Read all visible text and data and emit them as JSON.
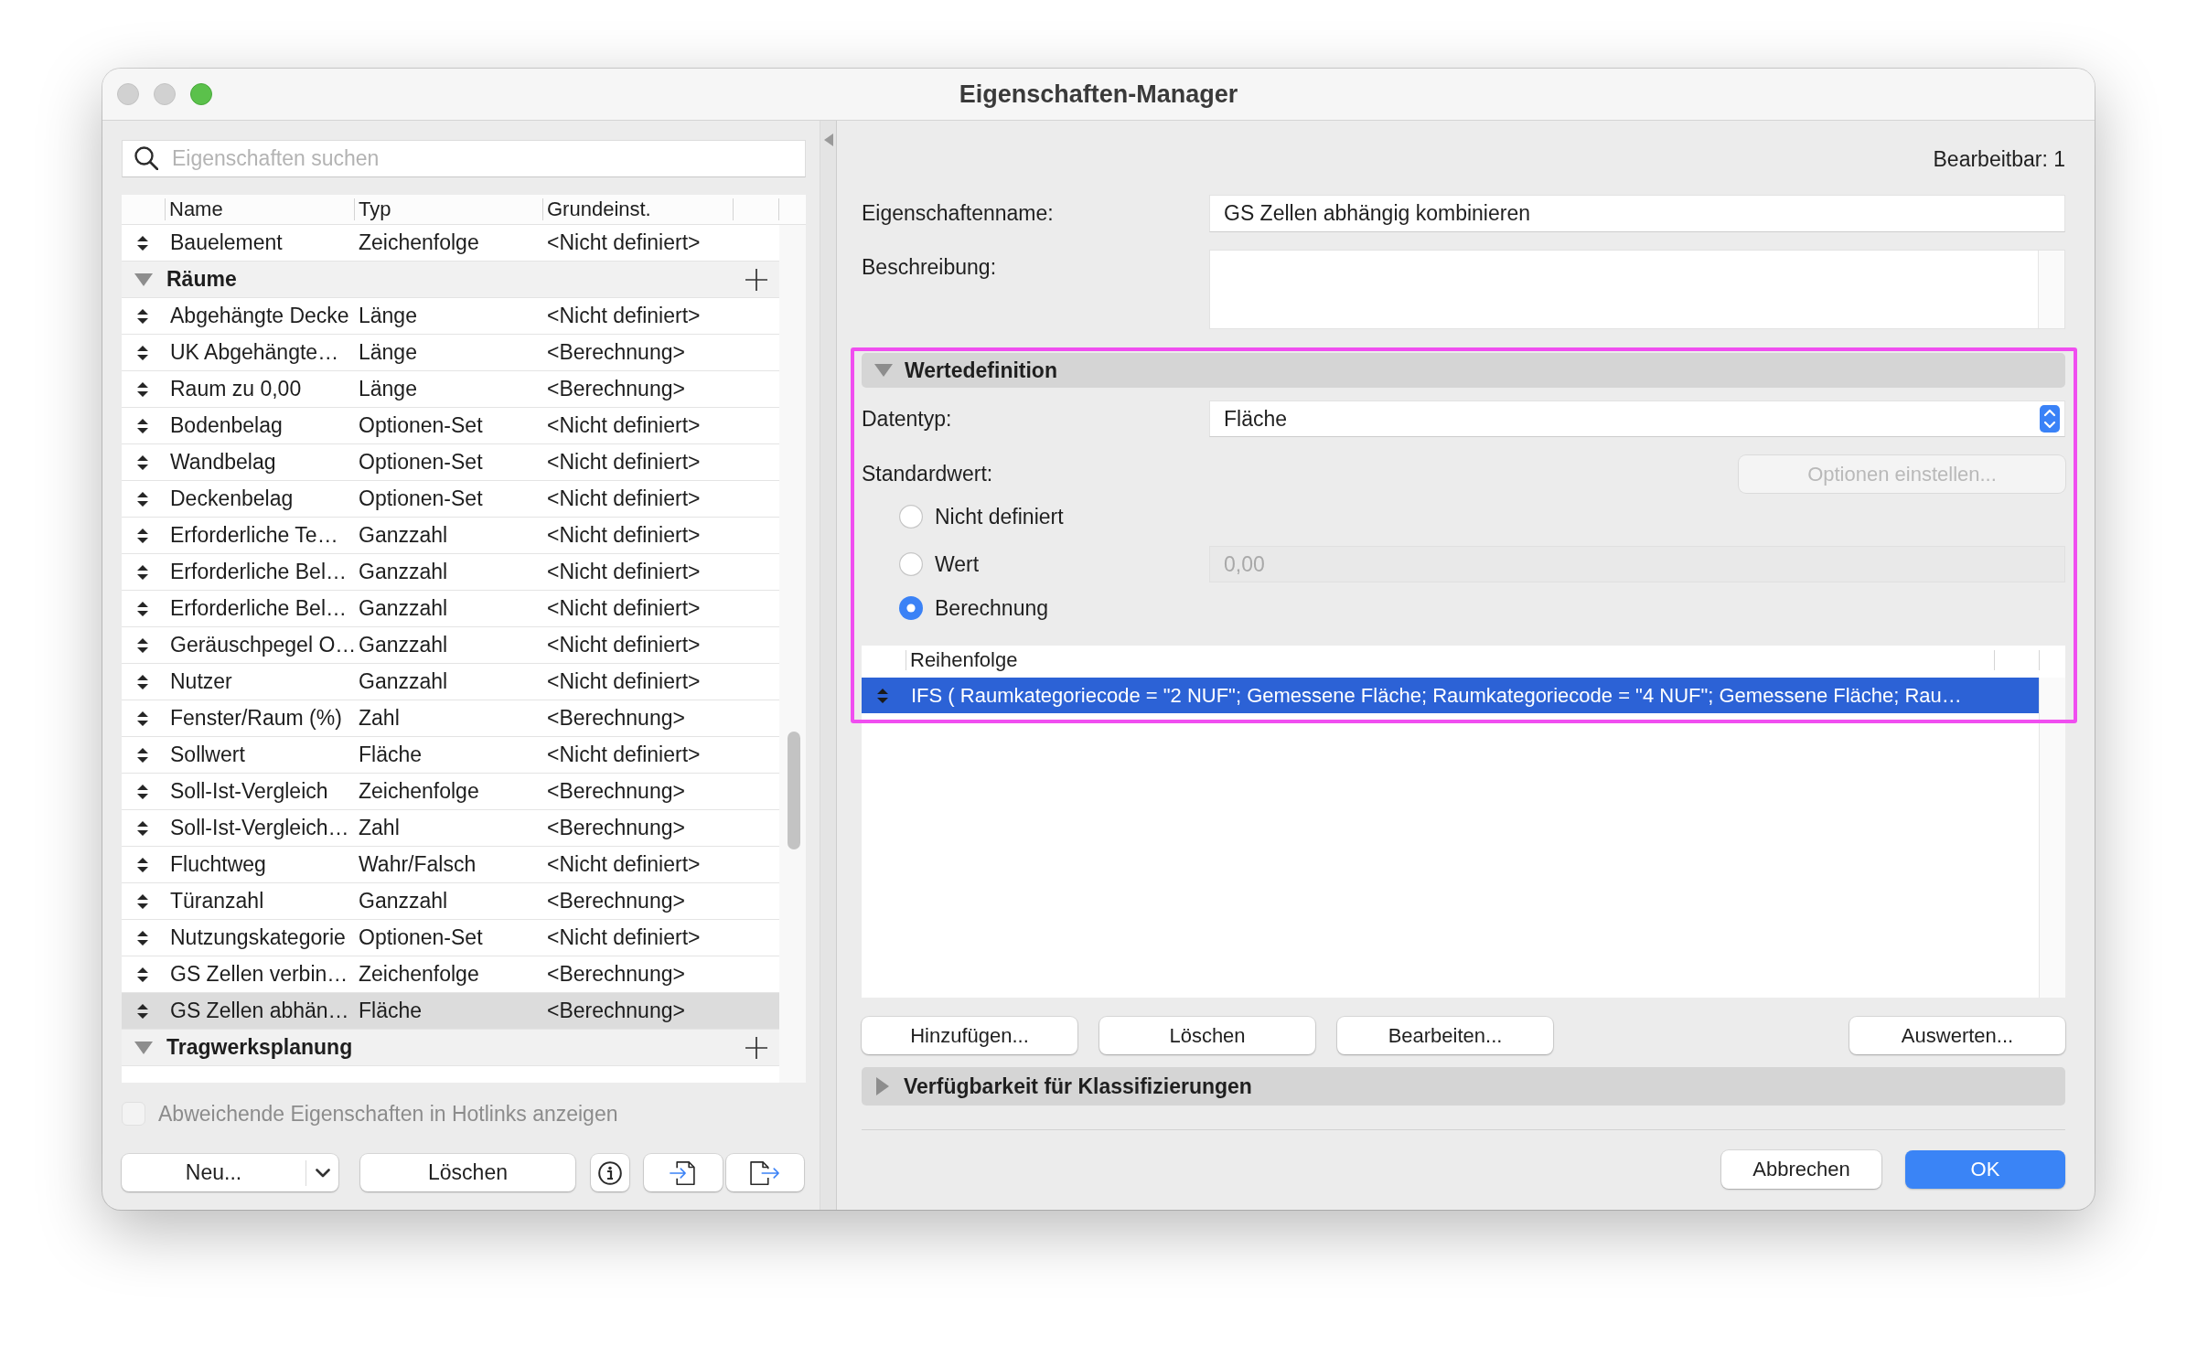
{
  "window": {
    "title": "Eigenschaften-Manager",
    "controls": [
      {
        "kind": "close",
        "disabled": true
      },
      {
        "kind": "minimize",
        "disabled": true
      },
      {
        "kind": "zoom",
        "disabled": false
      }
    ]
  },
  "search": {
    "placeholder": "Eigenschaften suchen"
  },
  "table": {
    "columns": [
      "Name",
      "Typ",
      "Grundeinst."
    ],
    "rows": [
      {
        "kind": "property",
        "name": "Bauelement",
        "type": "Zeichenfolge",
        "default": "<Nicht definiert>",
        "selected": false
      },
      {
        "kind": "group",
        "name": "Räume",
        "expanded": true,
        "children": [
          {
            "kind": "property",
            "name": "Abgehängte Decke",
            "type": "Länge",
            "default": "<Nicht definiert>",
            "selected": false
          },
          {
            "kind": "property",
            "name": "UK Abgehängte…",
            "type": "Länge",
            "default": "<Berechnung>",
            "selected": false
          },
          {
            "kind": "property",
            "name": "Raum zu 0,00",
            "type": "Länge",
            "default": "<Berechnung>",
            "selected": false
          },
          {
            "kind": "property",
            "name": "Bodenbelag",
            "type": "Optionen-Set",
            "default": "<Nicht definiert>",
            "selected": false
          },
          {
            "kind": "property",
            "name": "Wandbelag",
            "type": "Optionen-Set",
            "default": "<Nicht definiert>",
            "selected": false
          },
          {
            "kind": "property",
            "name": "Deckenbelag",
            "type": "Optionen-Set",
            "default": "<Nicht definiert>",
            "selected": false
          },
          {
            "kind": "property",
            "name": "Erforderliche Te…",
            "type": "Ganzzahl",
            "default": "<Nicht definiert>",
            "selected": false
          },
          {
            "kind": "property",
            "name": "Erforderliche Bel…",
            "type": "Ganzzahl",
            "default": "<Nicht definiert>",
            "selected": false
          },
          {
            "kind": "property",
            "name": "Erforderliche Bel…",
            "type": "Ganzzahl",
            "default": "<Nicht definiert>",
            "selected": false
          },
          {
            "kind": "property",
            "name": "Geräuschpegel O…",
            "type": "Ganzzahl",
            "default": "<Nicht definiert>",
            "selected": false
          },
          {
            "kind": "property",
            "name": "Nutzer",
            "type": "Ganzzahl",
            "default": "<Nicht definiert>",
            "selected": false
          },
          {
            "kind": "property",
            "name": "Fenster/Raum (%)",
            "type": "Zahl",
            "default": "<Berechnung>",
            "selected": false
          },
          {
            "kind": "property",
            "name": "Sollwert",
            "type": "Fläche",
            "default": "<Nicht definiert>",
            "selected": false
          },
          {
            "kind": "property",
            "name": "Soll-Ist-Vergleich",
            "type": "Zeichenfolge",
            "default": "<Berechnung>",
            "selected": false
          },
          {
            "kind": "property",
            "name": "Soll-Ist-Vergleich…",
            "type": "Zahl",
            "default": "<Berechnung>",
            "selected": false
          },
          {
            "kind": "property",
            "name": "Fluchtweg",
            "type": "Wahr/Falsch",
            "default": "<Nicht definiert>",
            "selected": false
          },
          {
            "kind": "property",
            "name": "Türanzahl",
            "type": "Ganzzahl",
            "default": "<Berechnung>",
            "selected": false
          },
          {
            "kind": "property",
            "name": "Nutzungskategorie",
            "type": "Optionen-Set",
            "default": "<Nicht definiert>",
            "selected": false
          },
          {
            "kind": "property",
            "name": "GS Zellen verbin…",
            "type": "Zeichenfolge",
            "default": "<Berechnung>",
            "selected": false
          },
          {
            "kind": "property",
            "name": "GS Zellen abhän…",
            "type": "Fläche",
            "default": "<Berechnung>",
            "selected": true
          }
        ]
      },
      {
        "kind": "group",
        "name": "Tragwerksplanung",
        "expanded": true
      }
    ]
  },
  "hotlinks_checkbox": {
    "label": "Abweichende Eigenschaften in Hotlinks anzeigen",
    "checked": false,
    "disabled": true
  },
  "list_buttons": [
    {
      "kind": "new",
      "label": "Neu..."
    },
    {
      "kind": "delete",
      "label": "Löschen"
    },
    {
      "kind": "info"
    },
    {
      "kind": "import"
    },
    {
      "kind": "export"
    }
  ],
  "editable_count": "Bearbeitbar: 1",
  "property_name": {
    "label": "Eigenschaftenname:",
    "value": "GS Zellen abhängig kombinieren"
  },
  "description": {
    "label": "Beschreibung:"
  },
  "value_definition": {
    "title": "Wertedefinition",
    "expanded": true,
    "highlighted": true,
    "data_type": {
      "label": "Datentyp:",
      "value": "Fläche"
    },
    "default_value": {
      "label": "Standardwert:",
      "options_button": {
        "label": "Optionen einstellen...",
        "disabled": true
      },
      "options": [
        {
          "label": "Nicht definiert",
          "selected": false
        },
        {
          "label": "Wert",
          "selected": false,
          "field": {
            "value": "0,00",
            "disabled": true
          }
        },
        {
          "label": "Berechnung",
          "selected": true
        }
      ]
    },
    "order_table": {
      "columns": [
        "Reihenfolge"
      ],
      "rows": [
        {
          "text": "IFS ( Raumkategoriecode = \"2 NUF\"; Gemessene Fläche; Raumkategoriecode = \"4 NUF\"; Gemessene Fläche; Rau…",
          "selected": true
        }
      ]
    }
  },
  "order_buttons": {
    "left": [
      {
        "label": "Hinzufügen..."
      },
      {
        "label": "Löschen"
      },
      {
        "label": "Bearbeiten..."
      }
    ],
    "right": [
      {
        "label": "Auswerten..."
      }
    ]
  },
  "classification": {
    "title": "Verfügbarkeit für Klassifizierungen",
    "expanded": false
  },
  "dialog_buttons": [
    {
      "label": "Abbrechen",
      "default": false
    },
    {
      "label": "OK",
      "default": true
    }
  ]
}
